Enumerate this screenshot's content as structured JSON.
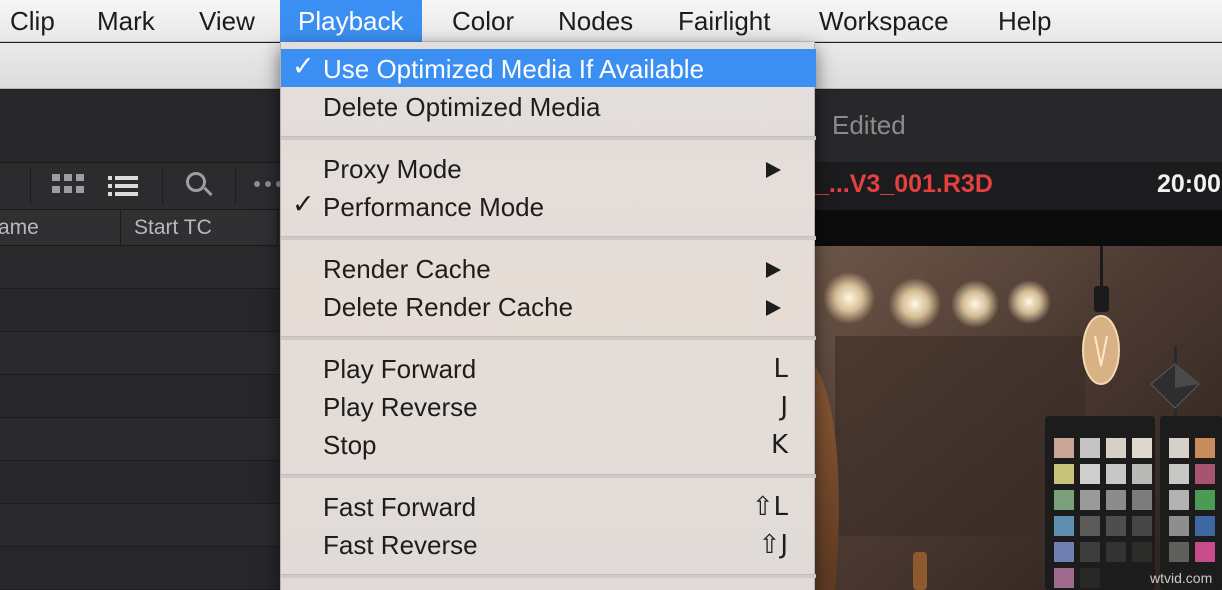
{
  "menubar": {
    "items": [
      {
        "label": "Clip"
      },
      {
        "label": "Mark"
      },
      {
        "label": "View"
      },
      {
        "label": "Playback",
        "active": true
      },
      {
        "label": "Color"
      },
      {
        "label": "Nodes"
      },
      {
        "label": "Fairlight"
      },
      {
        "label": "Workspace"
      },
      {
        "label": "Help"
      }
    ]
  },
  "playback_menu": {
    "groups": [
      [
        {
          "label": "Use Optimized Media If Available",
          "checked": true,
          "highlighted": true
        },
        {
          "label": "Delete Optimized Media"
        }
      ],
      [
        {
          "label": "Proxy Mode",
          "submenu": true
        },
        {
          "label": "Performance Mode",
          "checked": true
        }
      ],
      [
        {
          "label": "Render Cache",
          "submenu": true
        },
        {
          "label": "Delete Render Cache",
          "submenu": true
        }
      ],
      [
        {
          "label": "Play Forward",
          "shortcut": "L"
        },
        {
          "label": "Play Reverse",
          "shortcut": "J"
        },
        {
          "label": "Stop",
          "shortcut": "K"
        }
      ],
      [
        {
          "label": "Fast Forward",
          "shortcut": "⇧L"
        },
        {
          "label": "Fast Reverse",
          "shortcut": "⇧J"
        }
      ]
    ],
    "check_glyph": "✓"
  },
  "media_pool": {
    "columns": [
      "ame",
      "Start TC"
    ],
    "icons": [
      "grid-view-icon",
      "list-view-icon",
      "search-icon",
      "more-icon"
    ]
  },
  "header": {
    "status": "Edited"
  },
  "viewer": {
    "clip_name": "_...V3_001.R3D",
    "timecode": "20:00",
    "watermark": "wtvid.com"
  },
  "colors": {
    "accent": "#3c8ff2",
    "clip_name": "#e3413f",
    "app_bg": "#1e1e20"
  }
}
